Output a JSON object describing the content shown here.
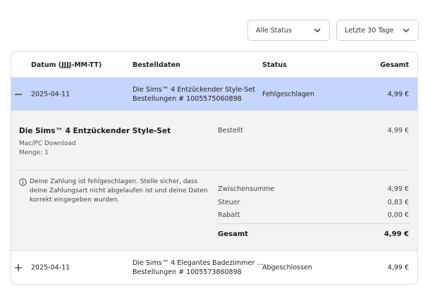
{
  "filters": {
    "status": "Alle Status",
    "period": "Letzte 30 Tage"
  },
  "table": {
    "headers": {
      "date": "Datum (JJJJ-MM-TT)",
      "order": "Bestelldaten",
      "status": "Status",
      "total": "Gesamt"
    },
    "rows": [
      {
        "toggle": "collapse",
        "date": "2025-04-11",
        "product": "Die Sims™ 4 Entzückender Style-Set",
        "order_number": "Bestellungen # 1005575060898",
        "status": "Fehlgeschlagen",
        "total": "4,99 €"
      },
      {
        "toggle": "expand",
        "date": "2025-04-11",
        "product": "Die Sims™ 4 Elegantes Badezimmer …",
        "order_number": "Bestellungen # 1005573860898",
        "status": "Abgeschlossen",
        "total": "4,99 €"
      }
    ]
  },
  "detail": {
    "title": "Die Sims™ 4 Entzückender Style-Set",
    "platform": "Mac/PC Download",
    "quantity": "Menge: 1",
    "ordered_label": "Bestellt",
    "ordered_value": "4,99 €",
    "warning": "Deine Zahlung ist fehlgeschlagen. Stelle sicher, dass deine Zahlungsart nicht abgelaufen ist und deine Daten korrekt eingegeben wurden.",
    "subtotal_label": "Zwischensumme",
    "subtotal_value": "4,99 €",
    "tax_label": "Steuer",
    "tax_value": "0,83 €",
    "discount_label": "Rabatt",
    "discount_value": "0,00 €",
    "total_label": "Gesamt",
    "total_value": "4,99 €"
  }
}
